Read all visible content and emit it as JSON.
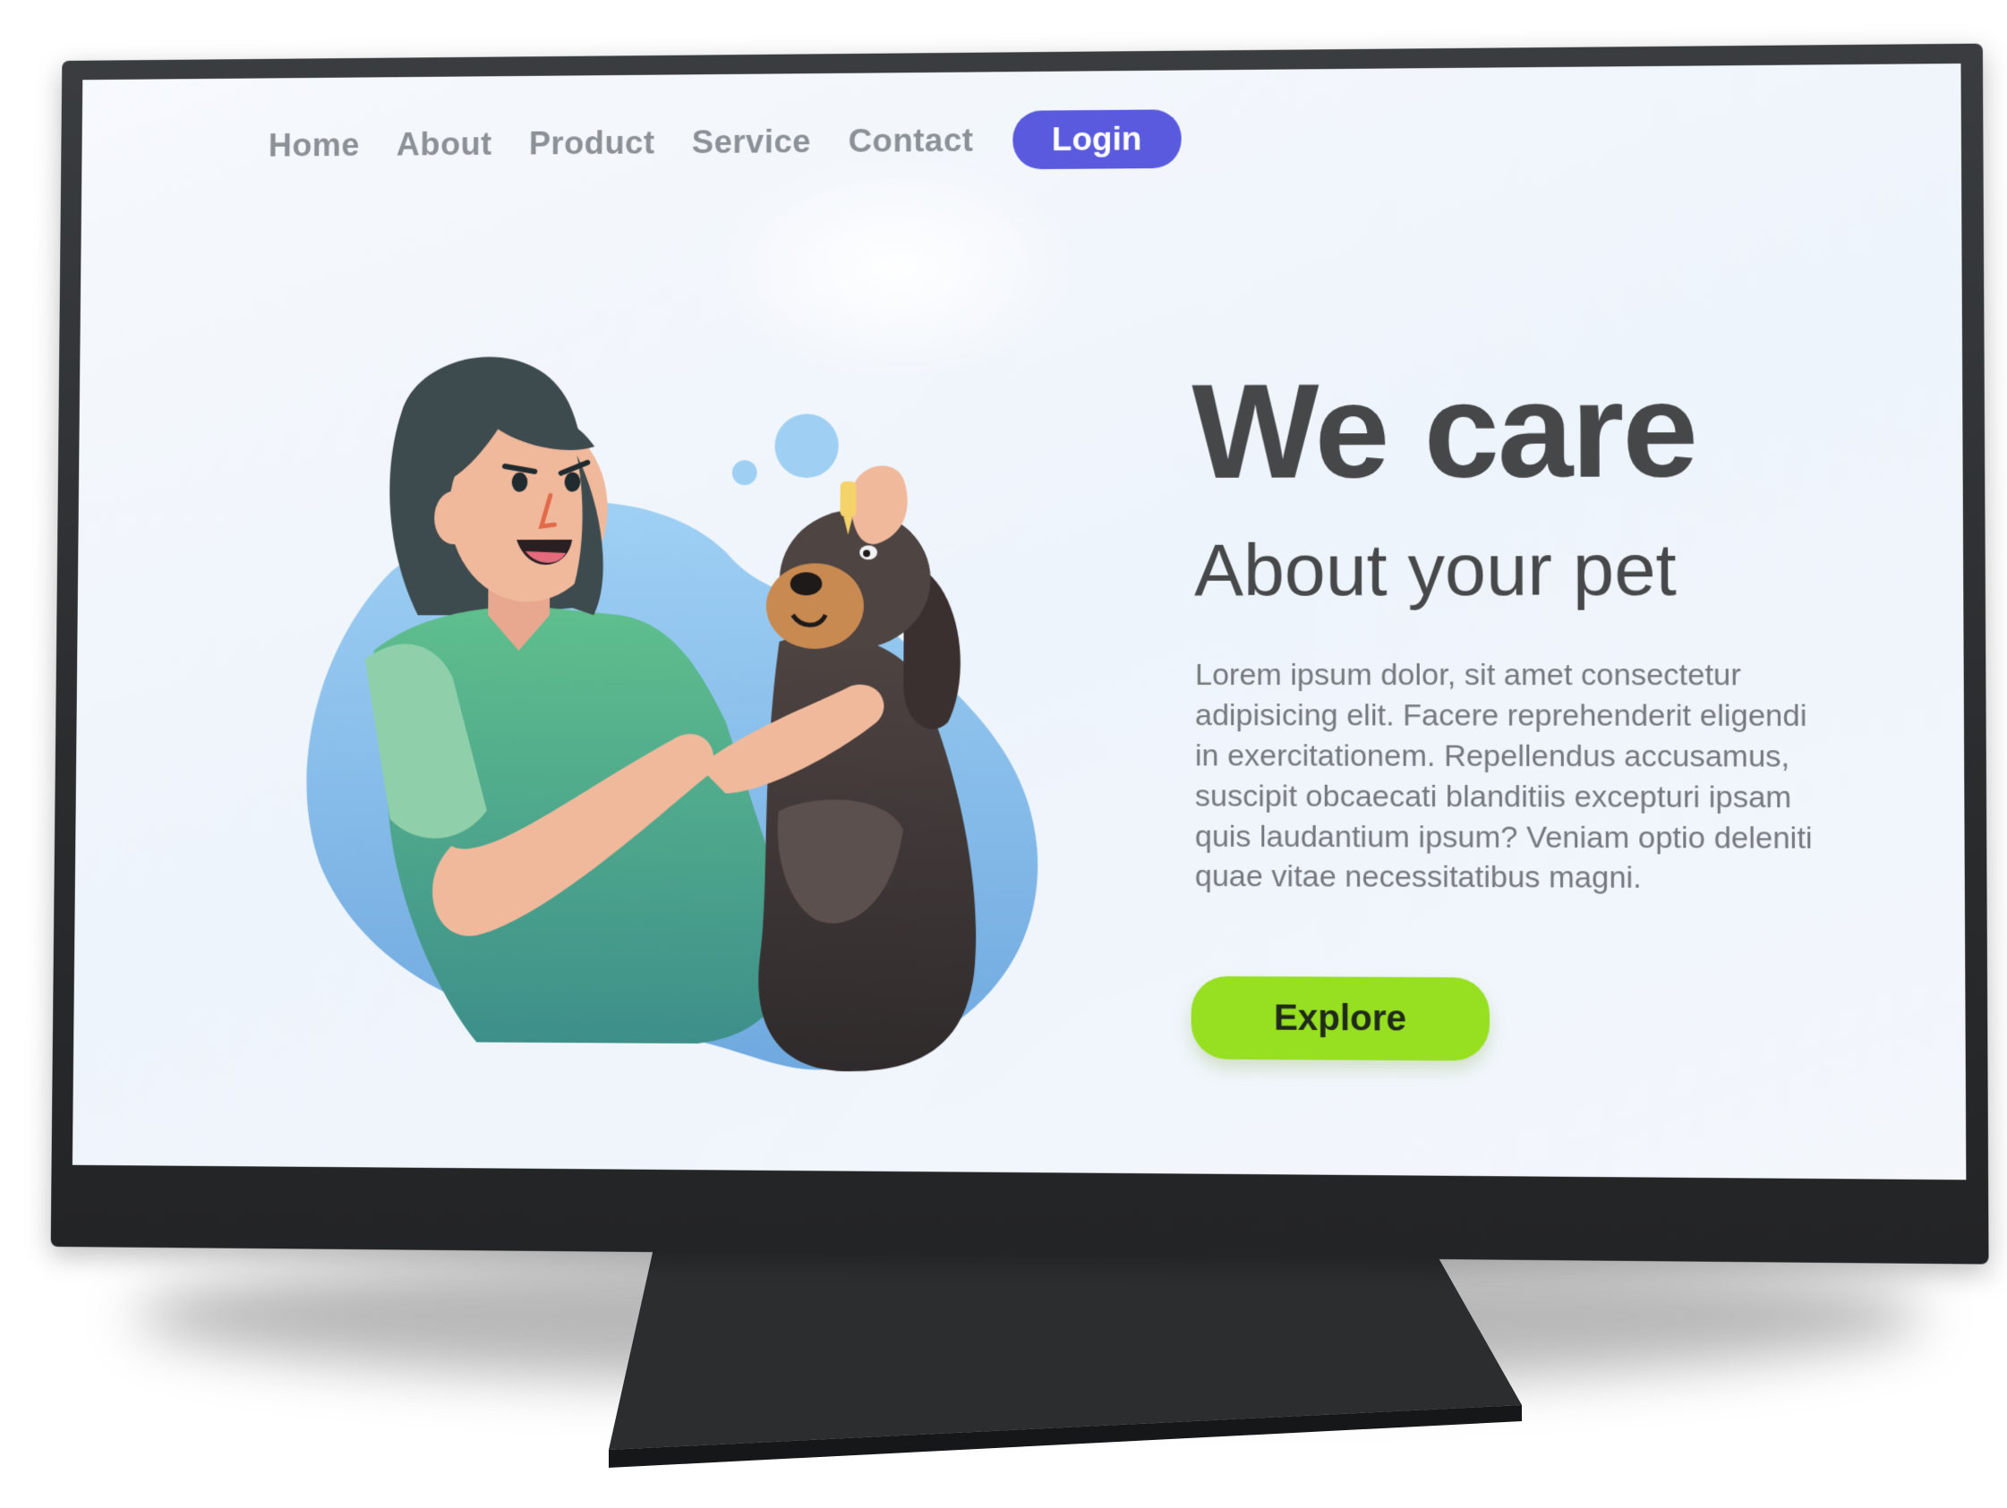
{
  "nav": {
    "items": [
      {
        "label": "Home"
      },
      {
        "label": "About"
      },
      {
        "label": "Product"
      },
      {
        "label": "Service"
      },
      {
        "label": "Contact"
      }
    ],
    "login_label": "Login"
  },
  "hero": {
    "title": "We care",
    "subtitle": "About your pet",
    "body": "Lorem ipsum dolor, sit amet consectetur adipisicing elit. Facere reprehenderit eligendi in exercitationem. Repellendus accusamus, suscipit obcaecati blanditiis excepturi ipsam quis laudantium ipsum? Veniam optio deleniti quae vitae necessitatibus magni.",
    "cta_label": "Explore"
  },
  "colors": {
    "accent_purple": "#5a5ade",
    "cta_green": "#97e021",
    "blob_blue": "#8cc3ef",
    "monitor_dark": "#2a2c2e"
  },
  "icons": {
    "illustration": "woman-caring-for-dog-illustration"
  }
}
